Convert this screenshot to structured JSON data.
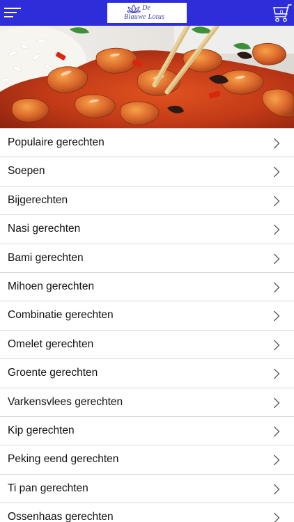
{
  "header": {
    "background_color": "#2d2dd9",
    "menu_icon": "hamburger-menu-icon",
    "logo": {
      "line1": "De",
      "line2": "Blauwe Lotus",
      "icon": "lotus-flower-icon"
    },
    "cart": {
      "icon": "shopping-cart-icon",
      "count": "0"
    }
  },
  "hero": {
    "image": "sweet-and-sour-chicken-with-rice-photo"
  },
  "categories": [
    {
      "label": "Populaire gerechten"
    },
    {
      "label": "Soepen"
    },
    {
      "label": "Bijgerechten"
    },
    {
      "label": "Nasi gerechten"
    },
    {
      "label": "Bami gerechten"
    },
    {
      "label": "Mihoen gerechten"
    },
    {
      "label": "Combinatie gerechten"
    },
    {
      "label": "Omelet gerechten"
    },
    {
      "label": "Groente gerechten"
    },
    {
      "label": "Varkensvlees gerechten"
    },
    {
      "label": "Kip gerechten"
    },
    {
      "label": "Peking eend gerechten"
    },
    {
      "label": "Ti pan gerechten"
    },
    {
      "label": "Ossenhaas gerechten"
    }
  ],
  "list_chevron_icon": "chevron-right-icon"
}
